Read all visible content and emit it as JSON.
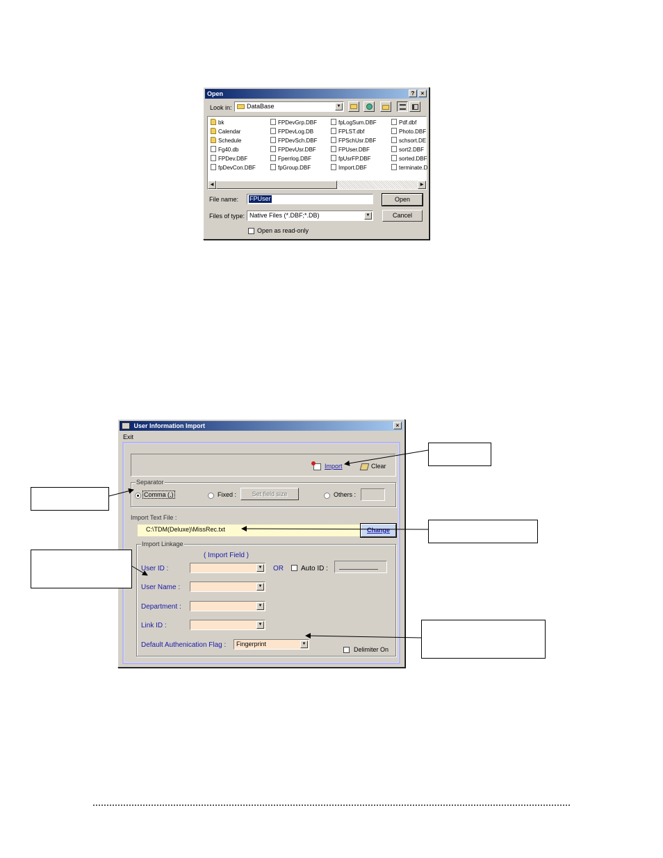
{
  "open_dialog": {
    "title": "Open",
    "help_btn": "?",
    "close_btn": "×",
    "look_in_label": "Look in:",
    "look_in_value": "DataBase",
    "files": [
      {
        "name": "bk",
        "type": "folder"
      },
      {
        "name": "Calendar",
        "type": "folder"
      },
      {
        "name": "Schedule",
        "type": "folder"
      },
      {
        "name": "Fg40.db",
        "type": "file"
      },
      {
        "name": "FPDev.DBF",
        "type": "file"
      },
      {
        "name": "fpDevCon.DBF",
        "type": "file"
      },
      {
        "name": "FPDevGrp.DBF",
        "type": "file"
      },
      {
        "name": "FPDevLog.DB",
        "type": "file"
      },
      {
        "name": "FPDevSch.DBF",
        "type": "file"
      },
      {
        "name": "FPDevUsr.DBF",
        "type": "file"
      },
      {
        "name": "Fperrlog.DBF",
        "type": "file"
      },
      {
        "name": "fpGroup.DBF",
        "type": "file"
      },
      {
        "name": "fpLogSum.DBF",
        "type": "file"
      },
      {
        "name": "FPLST.dbf",
        "type": "file"
      },
      {
        "name": "FPSchUsr.DBF",
        "type": "file"
      },
      {
        "name": "FPUser.DBF",
        "type": "file"
      },
      {
        "name": "fpUsrFP.DBF",
        "type": "file"
      },
      {
        "name": "Import.DBF",
        "type": "file"
      },
      {
        "name": "Pdf.dbf",
        "type": "file"
      },
      {
        "name": "Photo.DBF",
        "type": "file"
      },
      {
        "name": "schsort.DE",
        "type": "file"
      },
      {
        "name": "sort2.DBF",
        "type": "file"
      },
      {
        "name": "sorted.DBF",
        "type": "file"
      },
      {
        "name": "terminate.D",
        "type": "file"
      }
    ],
    "file_name_label": "File name:",
    "file_name_value": "FPUser",
    "files_of_type_label": "Files of type:",
    "files_of_type_value": "Native Files (*.DBF;*.DB)",
    "open_btn": "Open",
    "cancel_btn": "Cancel",
    "readonly_label": "Open as read-only"
  },
  "import_dialog": {
    "title": "User Information Import",
    "close_btn": "×",
    "menu_exit": "Exit",
    "import_btn": "Import",
    "clear_btn": "Clear",
    "separator_label": "Separator",
    "comma_label": "Comma (,)",
    "fixed_label": "Fixed :",
    "set_field_size_btn": "Set field size",
    "others_label": "Others :",
    "import_text_file_label": "Import Text File :",
    "import_text_file_value": "C:\\TDM(Deluxe)\\MissRec.txt",
    "change_btn": "Change",
    "import_linkage_label": "Import Linkage",
    "import_field_header": "( Import Field )",
    "user_id_label": "User ID :",
    "or_label": "OR",
    "auto_id_label": "Auto ID :",
    "user_name_label": "User Name :",
    "department_label": "Department :",
    "link_id_label": "Link ID :",
    "default_auth_label": "Default Authenication Flag :",
    "default_auth_value": "Fingerprint",
    "delimiter_label": "Delimiter On"
  },
  "colors": {
    "window_bg": "#d4d0c8",
    "title_start": "#0a246a",
    "title_end": "#a6caf0",
    "label_blue": "#1a1aa6",
    "field_peach": "#fde4cc",
    "path_yellow": "#fffbd0"
  }
}
